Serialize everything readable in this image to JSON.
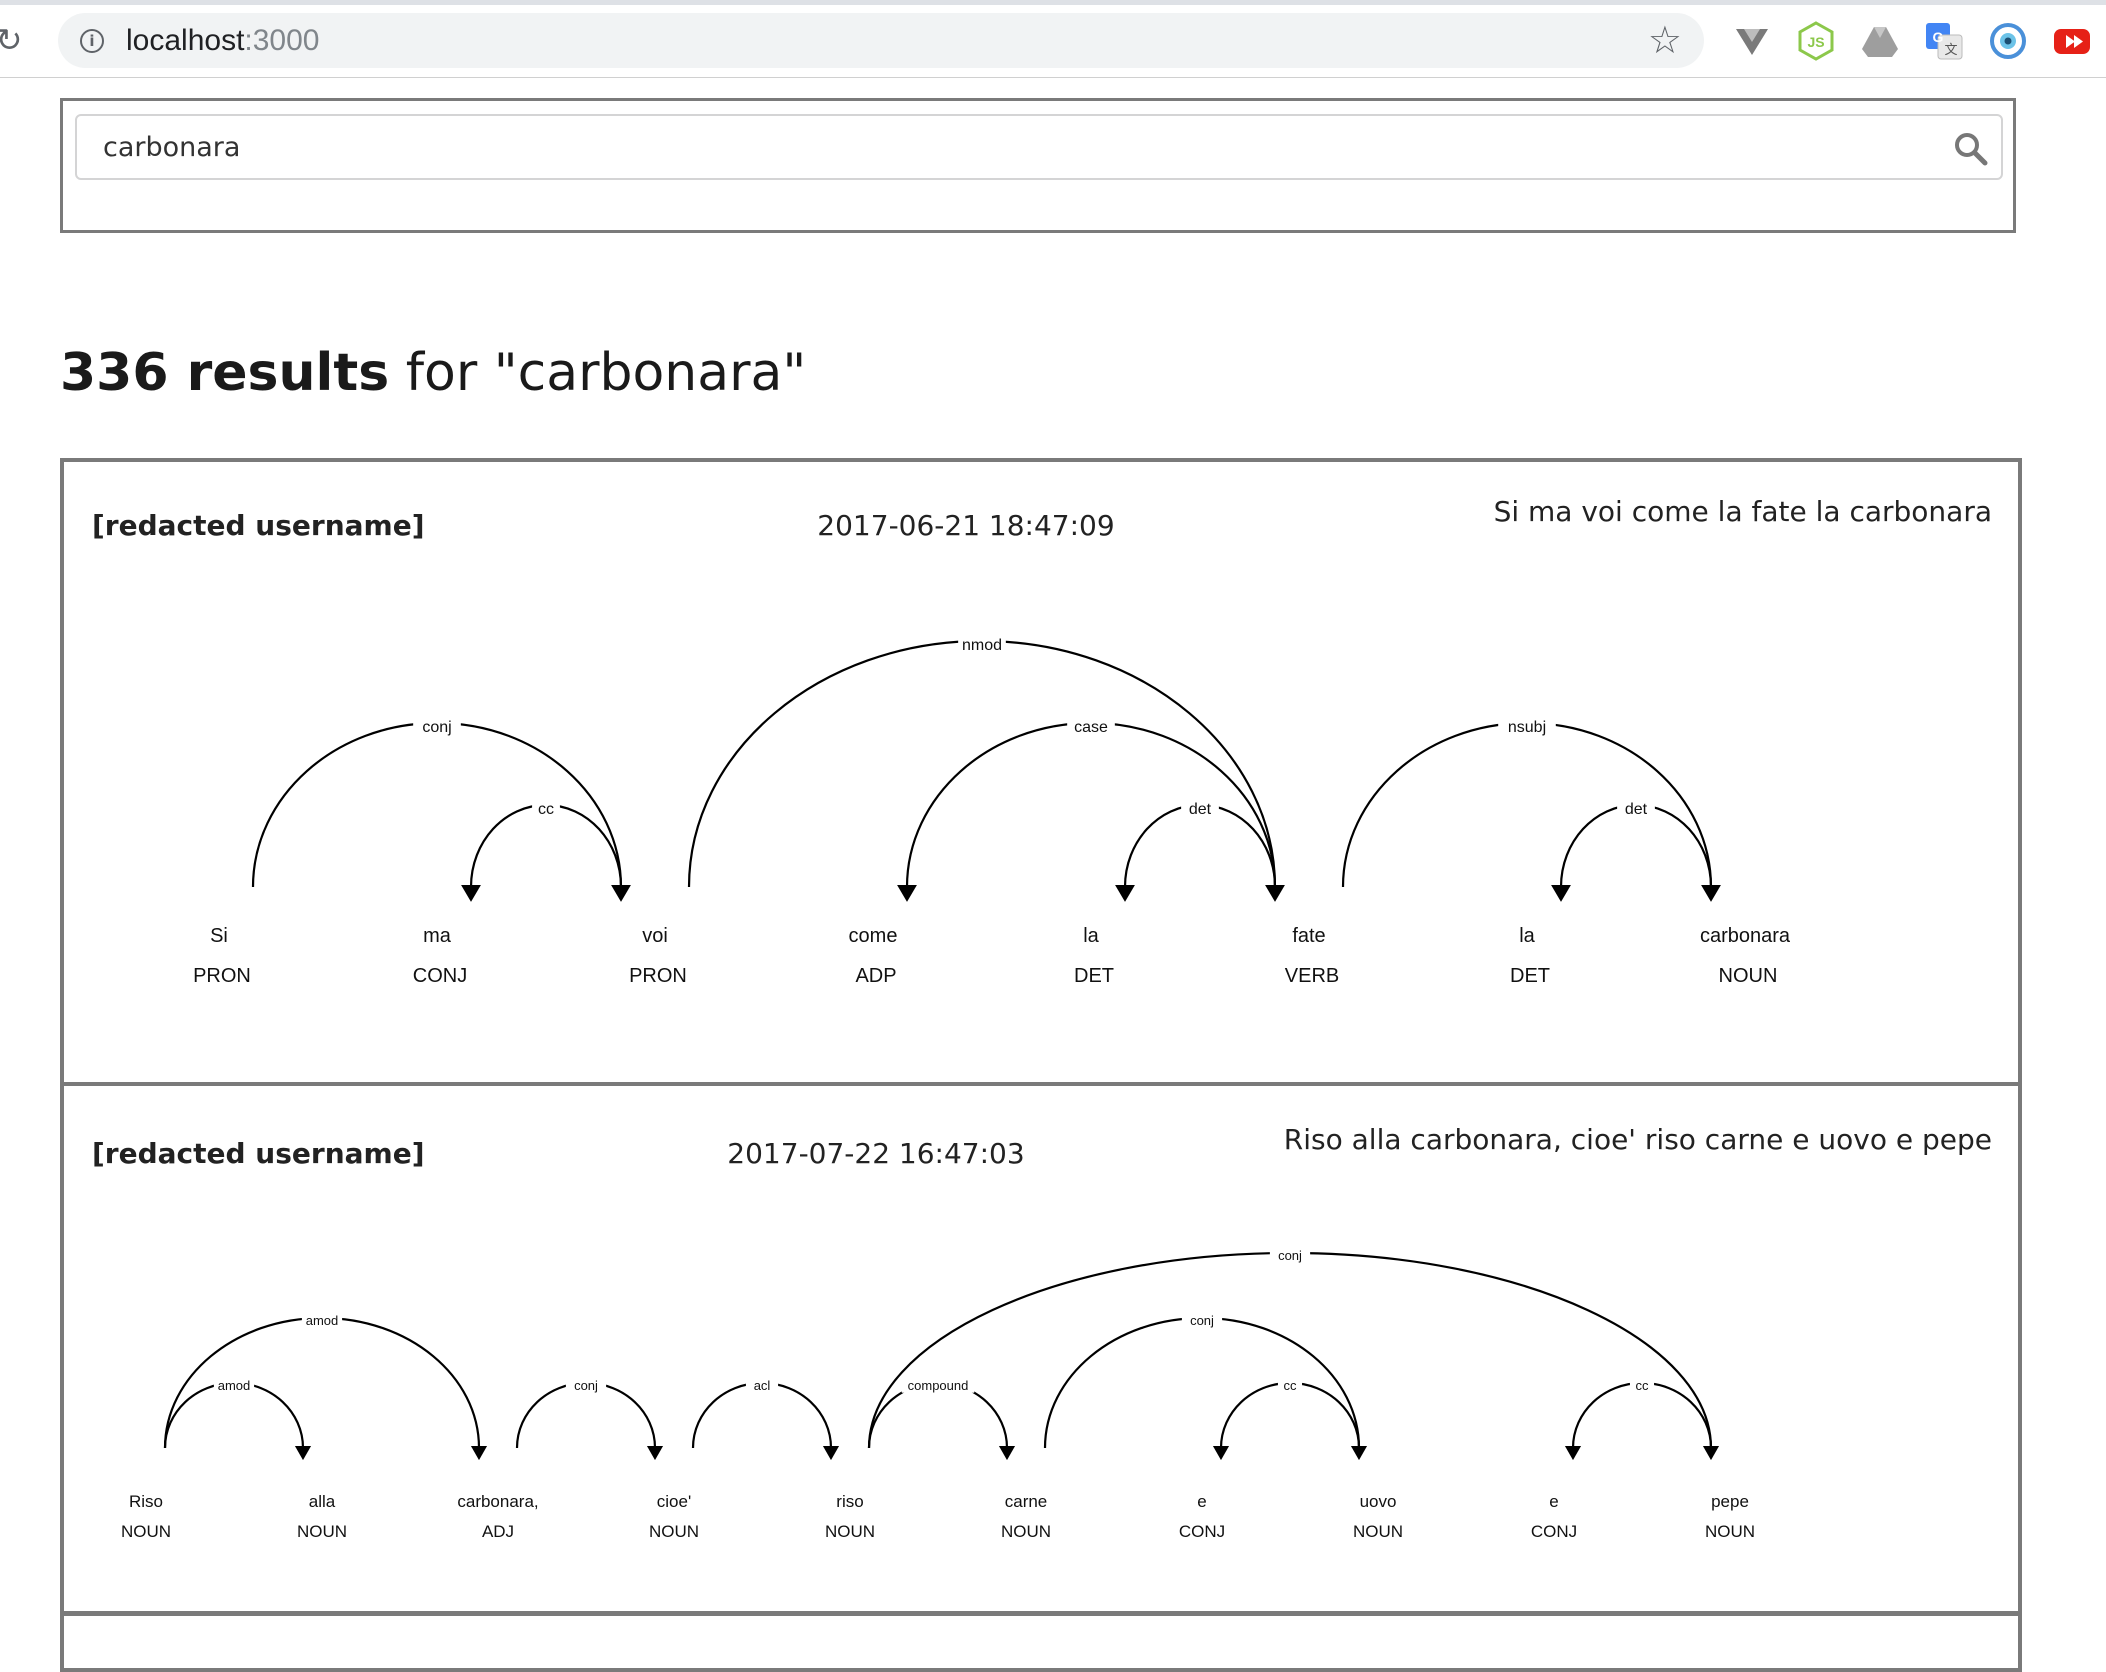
{
  "browser": {
    "url_host": "localhost",
    "url_port": ":3000",
    "extensions": [
      "vue-devtools-icon",
      "nodejs-icon",
      "google-drive-icon",
      "google-translate-icon",
      "eye-extension-icon",
      "youtube-icon"
    ]
  },
  "search": {
    "value": "carbonara"
  },
  "results": {
    "count": "336 results",
    "suffix": " for \"carbonara\""
  },
  "cards": [
    {
      "username": "[redacted username]",
      "date": "2017-06-21 18:47:09",
      "text": "Si ma voi come la fate la carbonara",
      "tokens": [
        {
          "word": "Si",
          "tag": "PRON"
        },
        {
          "word": "ma",
          "tag": "CONJ"
        },
        {
          "word": "voi",
          "tag": "PRON"
        },
        {
          "word": "come",
          "tag": "ADP"
        },
        {
          "word": "la",
          "tag": "DET"
        },
        {
          "word": "fate",
          "tag": "VERB"
        },
        {
          "word": "la",
          "tag": "DET"
        },
        {
          "word": "carbonara",
          "tag": "NOUN"
        }
      ],
      "arcs": [
        {
          "from": 0,
          "to": 2,
          "label": "conj"
        },
        {
          "from": 2,
          "to": 1,
          "label": "cc"
        },
        {
          "from": 2,
          "to": 5,
          "label": "nmod"
        },
        {
          "from": 5,
          "to": 3,
          "label": "case"
        },
        {
          "from": 5,
          "to": 4,
          "label": "det"
        },
        {
          "from": 5,
          "to": 7,
          "label": "nsubj"
        },
        {
          "from": 7,
          "to": 6,
          "label": "det"
        }
      ]
    },
    {
      "username": "[redacted username]",
      "date": "2017-07-22 16:47:03",
      "text": "Riso alla carbonara, cioe' riso carne e uovo e pepe",
      "tokens": [
        {
          "word": "Riso",
          "tag": "NOUN"
        },
        {
          "word": "alla",
          "tag": "NOUN"
        },
        {
          "word": "carbonara,",
          "tag": "ADJ"
        },
        {
          "word": "cioe'",
          "tag": "NOUN"
        },
        {
          "word": "riso",
          "tag": "NOUN"
        },
        {
          "word": "carne",
          "tag": "NOUN"
        },
        {
          "word": "e",
          "tag": "CONJ"
        },
        {
          "word": "uovo",
          "tag": "NOUN"
        },
        {
          "word": "e",
          "tag": "CONJ"
        },
        {
          "word": "pepe",
          "tag": "NOUN"
        }
      ],
      "arcs": [
        {
          "from": 0,
          "to": 1,
          "label": "amod"
        },
        {
          "from": 0,
          "to": 2,
          "label": "amod"
        },
        {
          "from": 2,
          "to": 3,
          "label": "conj"
        },
        {
          "from": 3,
          "to": 4,
          "label": "acl"
        },
        {
          "from": 4,
          "to": 5,
          "label": "compound"
        },
        {
          "from": 5,
          "to": 7,
          "label": "conj"
        },
        {
          "from": 7,
          "to": 6,
          "label": "cc"
        },
        {
          "from": 4,
          "to": 9,
          "label": "conj"
        },
        {
          "from": 9,
          "to": 8,
          "label": "cc"
        }
      ]
    }
  ]
}
